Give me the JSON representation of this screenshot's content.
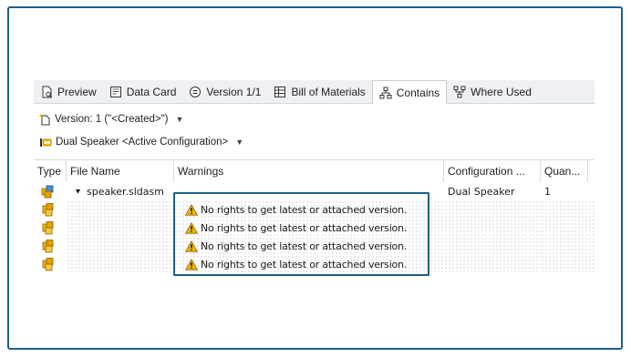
{
  "tabs": [
    {
      "label": "Preview",
      "icon": "preview-icon"
    },
    {
      "label": "Data Card",
      "icon": "data-card-icon"
    },
    {
      "label": "Version 1/1",
      "icon": "version-icon"
    },
    {
      "label": "Bill of Materials",
      "icon": "bill-of-materials-icon"
    },
    {
      "label": "Contains",
      "icon": "contains-icon",
      "active": true
    },
    {
      "label": "Where Used",
      "icon": "where-used-icon"
    }
  ],
  "version_selector": {
    "label": "Version: 1 (\"<Created>\")"
  },
  "configuration_selector": {
    "label": "Dual Speaker <Active Configuration>"
  },
  "columns": [
    "Type",
    "File Name",
    "Warnings",
    "Configuration ...",
    "Quan..."
  ],
  "rows": [
    {
      "file_name": "speaker.sldasm",
      "expand": "▾",
      "warning": "",
      "configuration": "Dual Speaker",
      "quantity": "1",
      "icon": "assembly-icon"
    },
    {
      "file_name": "",
      "warning": "No rights to get latest or attached version.",
      "configuration": "",
      "quantity": "",
      "icon": "part-icon"
    },
    {
      "file_name": "",
      "warning": "No rights to get latest or attached version.",
      "configuration": "",
      "quantity": "",
      "icon": "part-icon"
    },
    {
      "file_name": "",
      "warning": "No rights to get latest or attached version.",
      "configuration": "",
      "quantity": "",
      "icon": "part-icon"
    },
    {
      "file_name": "",
      "warning": "No rights to get latest or attached version.",
      "configuration": "",
      "quantity": "",
      "icon": "part-icon"
    }
  ],
  "colors": {
    "frame": "#1d5f8a",
    "highlight": "#1d5f8a",
    "warning": "#f2b705"
  }
}
